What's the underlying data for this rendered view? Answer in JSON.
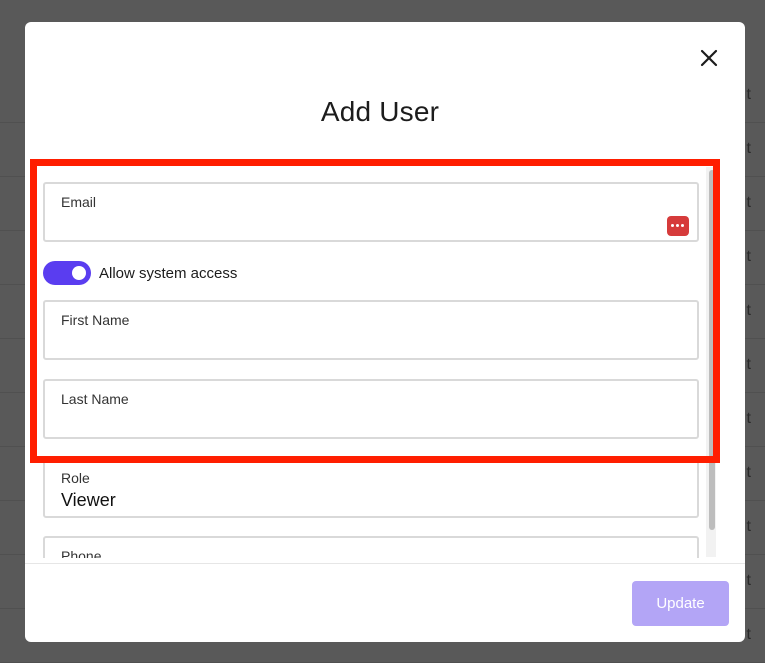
{
  "modal": {
    "title": "Add User",
    "close_label": "×"
  },
  "form": {
    "email": {
      "label": "Email",
      "value": "",
      "placeholder": ""
    },
    "system_access": {
      "label": "Allow system access",
      "enabled": true
    },
    "first_name": {
      "label": "First Name",
      "value": "",
      "placeholder": ""
    },
    "last_name": {
      "label": "Last Name",
      "value": "",
      "placeholder": ""
    },
    "role": {
      "label": "Role",
      "value": "Viewer"
    },
    "phone": {
      "label": "Phone"
    }
  },
  "footer": {
    "update_label": "Update"
  },
  "background": {
    "row_suffix": "t"
  },
  "colors": {
    "accent": "#5a3df0",
    "button_disabled": "#b3a5f6",
    "highlight": "#ff1e00",
    "password_manager": "#d63b3b"
  },
  "icons": {
    "close": "close-icon",
    "password_manager": "password-manager-icon"
  }
}
